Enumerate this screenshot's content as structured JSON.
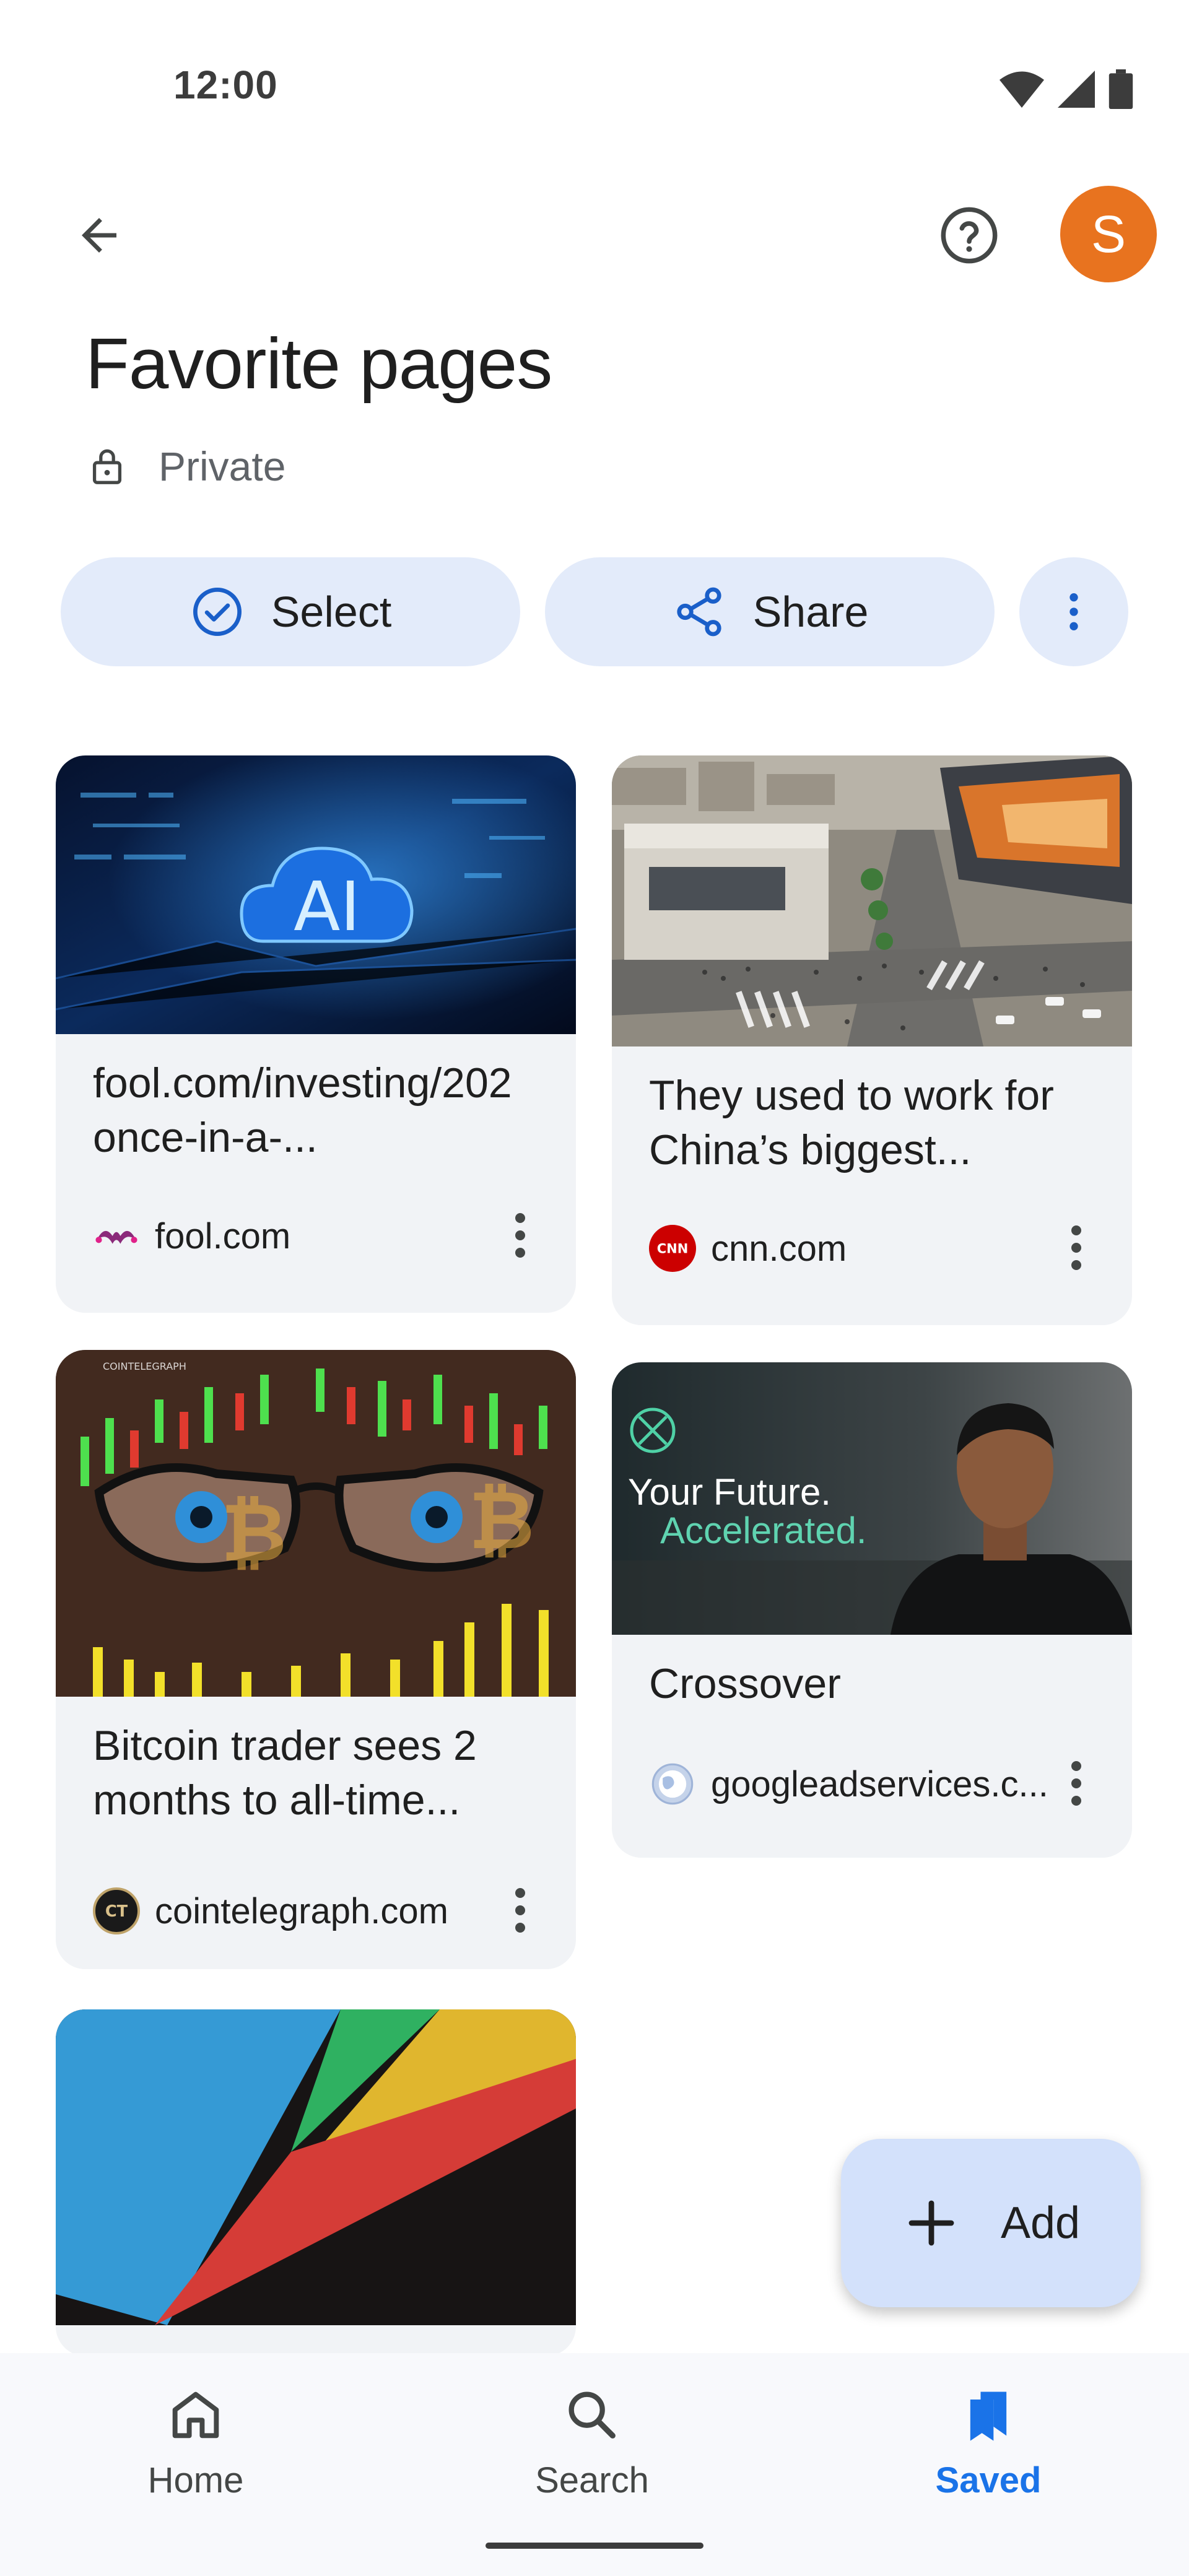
{
  "status_bar": {
    "time": "12:00"
  },
  "header": {
    "title": "Favorite pages",
    "privacy": "Private",
    "avatar_initial": "S"
  },
  "actions": {
    "select": "Select",
    "share": "Share"
  },
  "cards": [
    {
      "title": "fool.com/investing/202\nonce-in-a-...",
      "source": "fool.com",
      "favicon": "fool-jester-icon"
    },
    {
      "title": "They used to work for\nChina’s biggest...",
      "source": "cnn.com",
      "favicon": "cnn-logo-icon"
    },
    {
      "title": "Bitcoin trader sees 2\nmonths to all-time...",
      "source": "cointelegraph.com",
      "favicon": "cointelegraph-icon",
      "image_text": "COINTELEGRAPH"
    },
    {
      "title": "Crossover",
      "source": "googleadservices.c...",
      "favicon": "globe-icon",
      "image_text_1": "Your Future.",
      "image_text_2": "Accelerated."
    },
    {
      "title": "",
      "source": "",
      "favicon": "play-store-icon"
    }
  ],
  "thumbnails": {
    "card1_text": "AI"
  },
  "fab": {
    "label": "Add"
  },
  "bottom_nav": {
    "home": "Home",
    "search": "Search",
    "saved": "Saved"
  },
  "colors": {
    "accent": "#1a73e8",
    "avatar": "#e8731f",
    "chip_bg": "#e3ebfa",
    "card_bg": "#f1f3f6",
    "fab_bg": "#d3e1fb"
  }
}
